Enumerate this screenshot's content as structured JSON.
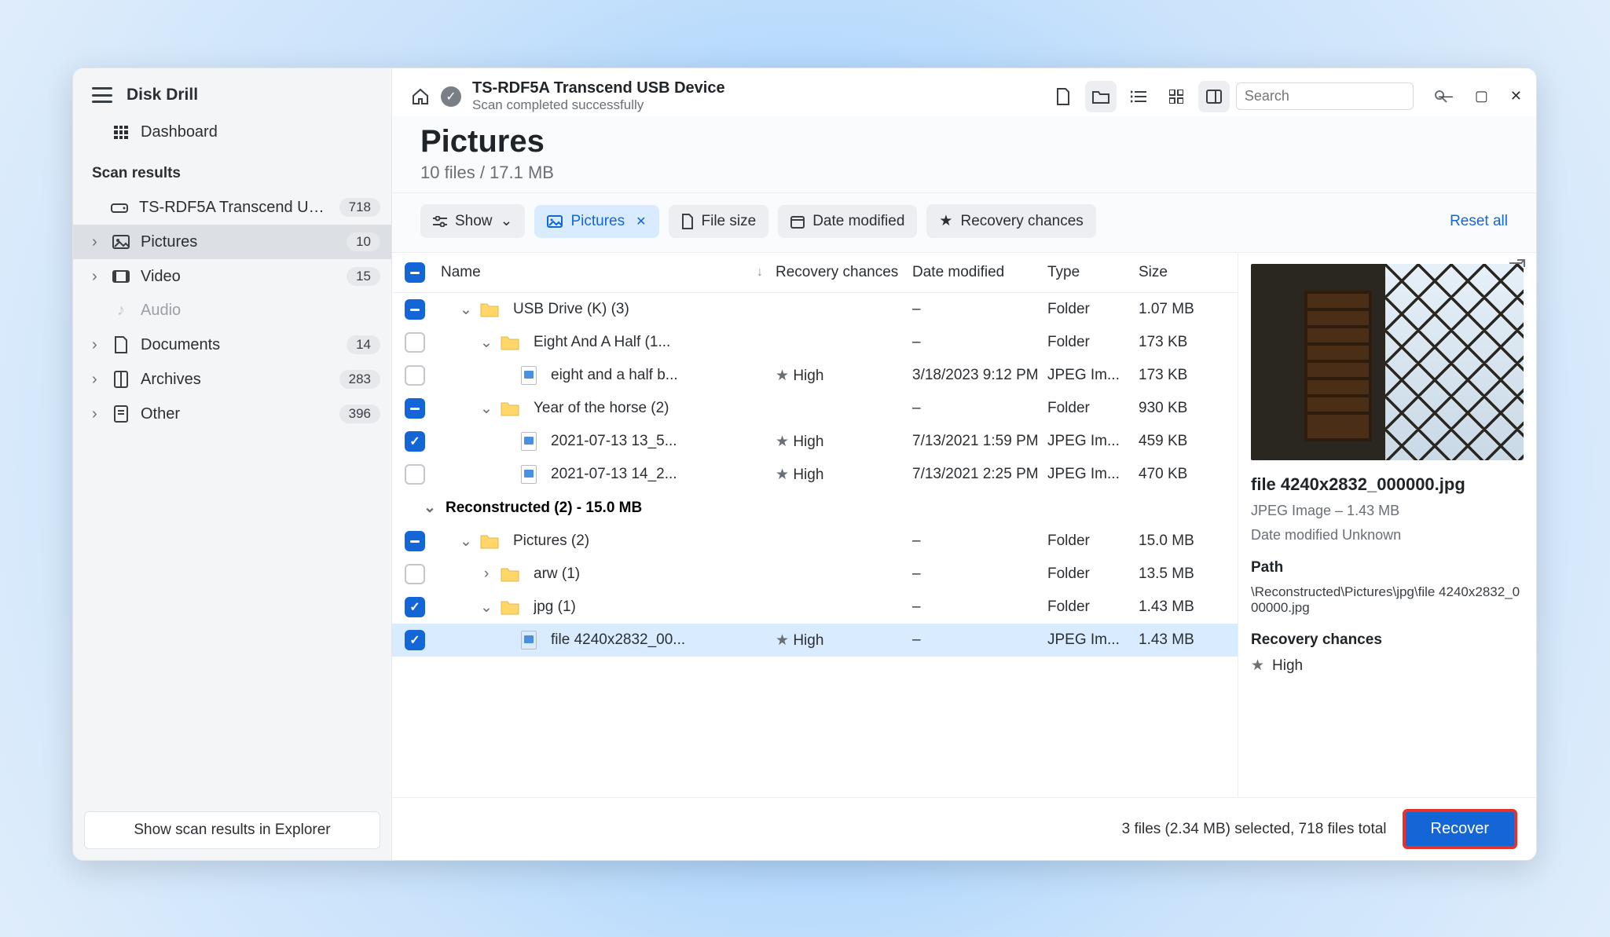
{
  "app": {
    "title": "Disk Drill"
  },
  "sidebar": {
    "dashboard": "Dashboard",
    "section": "Scan results",
    "device": {
      "label": "TS-RDF5A Transcend US...",
      "count": "718"
    },
    "items": [
      {
        "label": "Pictures",
        "count": "10",
        "active": true
      },
      {
        "label": "Video",
        "count": "15"
      },
      {
        "label": "Audio",
        "muted": true
      },
      {
        "label": "Documents",
        "count": "14"
      },
      {
        "label": "Archives",
        "count": "283"
      },
      {
        "label": "Other",
        "count": "396"
      }
    ],
    "footer_btn": "Show scan results in Explorer"
  },
  "topbar": {
    "title": "TS-RDF5A Transcend USB Device",
    "subtitle": "Scan completed successfully",
    "search_placeholder": "Search"
  },
  "header": {
    "title": "Pictures",
    "subtitle": "10 files / 17.1 MB"
  },
  "filters": {
    "show": "Show",
    "pictures": "Pictures",
    "filesize": "File size",
    "datemod": "Date modified",
    "recchance": "Recovery chances",
    "reset": "Reset all"
  },
  "columns": {
    "name": "Name",
    "rec": "Recovery chances",
    "date": "Date modified",
    "type": "Type",
    "size": "Size"
  },
  "rows": [
    {
      "cbx": "partial",
      "indent": 1,
      "chev": "down",
      "icon": "folder",
      "name": "USB Drive (K) (3)",
      "rec": "",
      "date": "–",
      "type": "Folder",
      "size": "1.07 MB"
    },
    {
      "cbx": "empty",
      "indent": 2,
      "chev": "down",
      "icon": "folder",
      "name": "Eight And A Half (1...",
      "rec": "",
      "date": "–",
      "type": "Folder",
      "size": "173 KB"
    },
    {
      "cbx": "empty",
      "indent": 3,
      "chev": "",
      "icon": "file",
      "name": "eight and a half b...",
      "rec": "High",
      "date": "3/18/2023 9:12 PM",
      "type": "JPEG Im...",
      "size": "173 KB"
    },
    {
      "cbx": "partial",
      "indent": 2,
      "chev": "down",
      "icon": "folder",
      "name": "Year of the horse (2)",
      "rec": "",
      "date": "–",
      "type": "Folder",
      "size": "930 KB"
    },
    {
      "cbx": "checked",
      "indent": 3,
      "chev": "",
      "icon": "file",
      "name": "2021-07-13 13_5...",
      "rec": "High",
      "date": "7/13/2021 1:59 PM",
      "type": "JPEG Im...",
      "size": "459 KB"
    },
    {
      "cbx": "empty",
      "indent": 3,
      "chev": "",
      "icon": "file",
      "name": "2021-07-13 14_2...",
      "rec": "High",
      "date": "7/13/2021 2:25 PM",
      "type": "JPEG Im...",
      "size": "470 KB"
    }
  ],
  "group": "Reconstructed (2) - 15.0 MB",
  "rows2": [
    {
      "cbx": "partial",
      "indent": 1,
      "chev": "down",
      "icon": "folder",
      "name": "Pictures (2)",
      "rec": "",
      "date": "–",
      "type": "Folder",
      "size": "15.0 MB"
    },
    {
      "cbx": "empty",
      "indent": 2,
      "chev": "right",
      "icon": "folder",
      "name": "arw (1)",
      "rec": "",
      "date": "–",
      "type": "Folder",
      "size": "13.5 MB"
    },
    {
      "cbx": "checked",
      "indent": 2,
      "chev": "down",
      "icon": "folder",
      "name": "jpg (1)",
      "rec": "",
      "date": "–",
      "type": "Folder",
      "size": "1.43 MB"
    },
    {
      "cbx": "checked",
      "indent": 3,
      "chev": "",
      "icon": "file",
      "name": "file 4240x2832_00...",
      "rec": "High",
      "date": "–",
      "type": "JPEG Im...",
      "size": "1.43 MB",
      "selected": true
    }
  ],
  "footer": {
    "status": "3 files (2.34 MB) selected, 718 files total",
    "recover": "Recover"
  },
  "preview": {
    "filename": "file 4240x2832_000000.jpg",
    "typeline": "JPEG Image – 1.43 MB",
    "dateline": "Date modified Unknown",
    "path_label": "Path",
    "path": "\\Reconstructed\\Pictures\\jpg\\file 4240x2832_000000.jpg",
    "rec_label": "Recovery chances",
    "rec_value": "High"
  }
}
